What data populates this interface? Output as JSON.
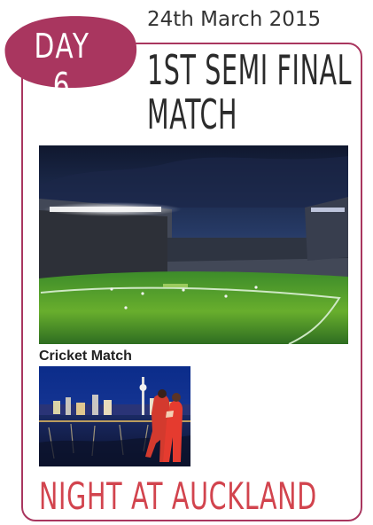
{
  "header": {
    "day_label": "DAY 6",
    "date": "24th March 2015"
  },
  "event": {
    "title_line_1": "1ST SEMI FINAL",
    "title_line_2": "MATCH"
  },
  "photos": {
    "stadium_caption": "Cricket Match"
  },
  "footer": {
    "night_title": "NIGHT AT AUCKLAND"
  },
  "colors": {
    "accent": "#a9365f",
    "title_text": "#2b2b2b",
    "night_title": "#d2444e"
  },
  "icons": {
    "badge": "day-badge-blob"
  }
}
